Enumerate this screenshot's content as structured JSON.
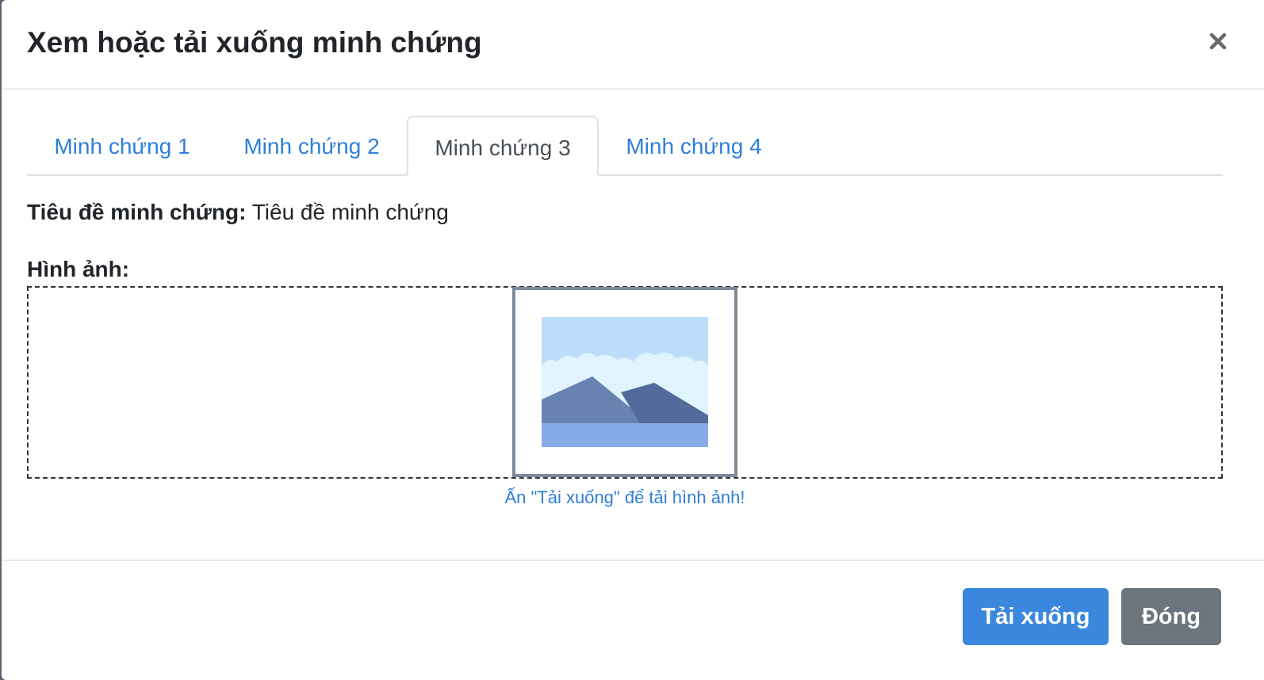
{
  "modal": {
    "title": "Xem hoặc tải xuống minh chứng",
    "close_icon": "close-icon"
  },
  "tabs": [
    {
      "label": "Minh chứng 1",
      "active": false
    },
    {
      "label": "Minh chứng 2",
      "active": false
    },
    {
      "label": "Minh chứng 3",
      "active": true
    },
    {
      "label": "Minh chứng 4",
      "active": false
    }
  ],
  "content": {
    "title_label": "Tiêu đề minh chứng:",
    "title_value": "Tiêu đề minh chứng",
    "image_label": "Hình ảnh:",
    "image_icon": "image-placeholder-icon",
    "hint": "Ấn \"Tải xuống\" để tải hình ảnh!"
  },
  "footer": {
    "download_label": "Tải xuống",
    "close_label": "Đóng"
  },
  "colors": {
    "link": "#2f80d6",
    "primary": "#3a87dd",
    "secondary": "#6c757d"
  }
}
